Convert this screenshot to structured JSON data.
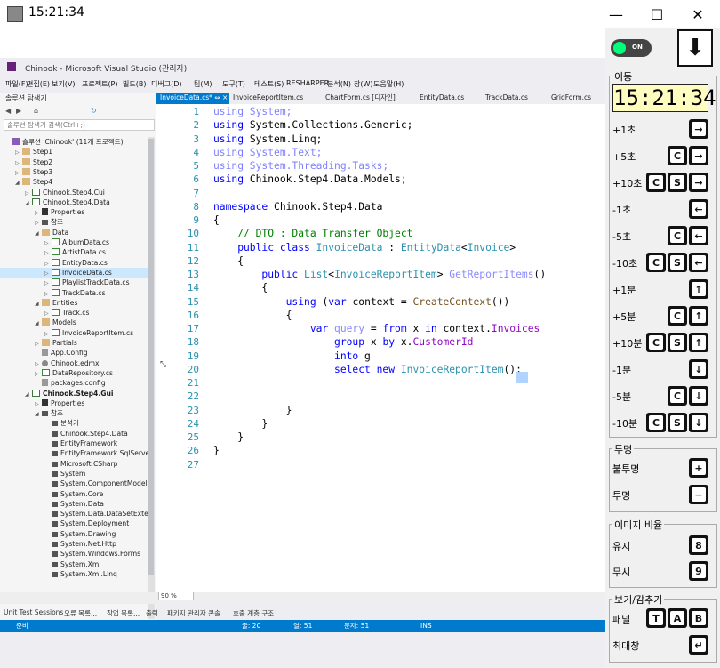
{
  "outer": {
    "time": "15:21:34",
    "minimize": "—",
    "maximize": "☐",
    "close": "✕"
  },
  "vs": {
    "title": "Chinook - Microsoft Visual Studio (관리자)",
    "menu": [
      "파일(F)",
      "편집(E)",
      "보기(V)",
      "프로젝트(P)",
      "빌드(B)",
      "디버그(D)",
      "팀(M)",
      "도구(T)",
      "테스트(S)",
      "RESHARPER",
      "분석(N)",
      "창(W)",
      "도움말(H)"
    ],
    "solution_explorer": {
      "header": "솔루션 탐색기",
      "search_placeholder": "솔루션 탐색기 검색(Ctrl+;)",
      "items": [
        {
          "text": "솔루션 'Chinook' (11개 프로젝트)",
          "indent": 0,
          "icon": "sol",
          "tri": ""
        },
        {
          "text": "Step1",
          "indent": 1,
          "icon": "folder",
          "tri": "▷"
        },
        {
          "text": "Step2",
          "indent": 1,
          "icon": "folder",
          "tri": "▷"
        },
        {
          "text": "Step3",
          "indent": 1,
          "icon": "folder",
          "tri": "▷"
        },
        {
          "text": "Step4",
          "indent": 1,
          "icon": "folder",
          "tri": "◢"
        },
        {
          "text": "Chinook.Step4.Cui",
          "indent": 2,
          "icon": "proj",
          "tri": "▷"
        },
        {
          "text": "Chinook.Step4.Data",
          "indent": 2,
          "icon": "proj",
          "tri": "◢"
        },
        {
          "text": "Properties",
          "indent": 3,
          "icon": "wrench",
          "tri": "▷"
        },
        {
          "text": "참조",
          "indent": 3,
          "icon": "ref",
          "tri": "▷"
        },
        {
          "text": "Data",
          "indent": 3,
          "icon": "folder",
          "tri": "◢"
        },
        {
          "text": "AlbumData.cs",
          "indent": 4,
          "icon": "cs",
          "tri": "▷"
        },
        {
          "text": "ArtistData.cs",
          "indent": 4,
          "icon": "cs",
          "tri": "▷"
        },
        {
          "text": "EntityData.cs",
          "indent": 4,
          "icon": "cs",
          "tri": "▷"
        },
        {
          "text": "InvoiceData.cs",
          "indent": 4,
          "icon": "cs",
          "tri": "▷",
          "selected": true
        },
        {
          "text": "PlaylistTrackData.cs",
          "indent": 4,
          "icon": "cs",
          "tri": "▷"
        },
        {
          "text": "TrackData.cs",
          "indent": 4,
          "icon": "cs",
          "tri": "▷"
        },
        {
          "text": "Entities",
          "indent": 3,
          "icon": "folder",
          "tri": "◢"
        },
        {
          "text": "Track.cs",
          "indent": 4,
          "icon": "cs",
          "tri": "▷"
        },
        {
          "text": "Models",
          "indent": 3,
          "icon": "folder",
          "tri": "◢"
        },
        {
          "text": "InvoiceReportItem.cs",
          "indent": 4,
          "icon": "cs",
          "tri": "▷"
        },
        {
          "text": "Partials",
          "indent": 3,
          "icon": "folder",
          "tri": "▷"
        },
        {
          "text": "App.Config",
          "indent": 3,
          "icon": "cfg",
          "tri": ""
        },
        {
          "text": "Chinook.edmx",
          "indent": 3,
          "icon": "gear",
          "tri": "▷"
        },
        {
          "text": "DataRepository.cs",
          "indent": 3,
          "icon": "cs",
          "tri": "▷"
        },
        {
          "text": "packages.config",
          "indent": 3,
          "icon": "cfg",
          "tri": ""
        },
        {
          "text": "Chinook.Step4.Gui",
          "indent": 2,
          "icon": "proj",
          "tri": "◢",
          "bold": true
        },
        {
          "text": "Properties",
          "indent": 3,
          "icon": "wrench",
          "tri": "▷"
        },
        {
          "text": "참조",
          "indent": 3,
          "icon": "ref",
          "tri": "◢"
        },
        {
          "text": "분석기",
          "indent": 4,
          "icon": "ref",
          "tri": ""
        },
        {
          "text": "Chinook.Step4.Data",
          "indent": 4,
          "icon": "ref",
          "tri": ""
        },
        {
          "text": "EntityFramework",
          "indent": 4,
          "icon": "ref",
          "tri": ""
        },
        {
          "text": "EntityFramework.SqlServer",
          "indent": 4,
          "icon": "ref",
          "tri": ""
        },
        {
          "text": "Microsoft.CSharp",
          "indent": 4,
          "icon": "ref",
          "tri": ""
        },
        {
          "text": "System",
          "indent": 4,
          "icon": "ref",
          "tri": ""
        },
        {
          "text": "System.ComponentModel.D",
          "indent": 4,
          "icon": "ref",
          "tri": ""
        },
        {
          "text": "System.Core",
          "indent": 4,
          "icon": "ref",
          "tri": ""
        },
        {
          "text": "System.Data",
          "indent": 4,
          "icon": "ref",
          "tri": ""
        },
        {
          "text": "System.Data.DataSetExtens",
          "indent": 4,
          "icon": "ref",
          "tri": ""
        },
        {
          "text": "System.Deployment",
          "indent": 4,
          "icon": "ref",
          "tri": ""
        },
        {
          "text": "System.Drawing",
          "indent": 4,
          "icon": "ref",
          "tri": ""
        },
        {
          "text": "System.Net.Http",
          "indent": 4,
          "icon": "ref",
          "tri": ""
        },
        {
          "text": "System.Windows.Forms",
          "indent": 4,
          "icon": "ref",
          "tri": ""
        },
        {
          "text": "System.Xml",
          "indent": 4,
          "icon": "ref",
          "tri": ""
        },
        {
          "text": "System.Xml.Linq",
          "indent": 4,
          "icon": "ref",
          "tri": ""
        }
      ]
    },
    "tabs": [
      "InvoiceData.cs* ⇔ ×",
      "InvoiceReportItem.cs",
      "ChartForm.cs [디자인]",
      "EntityData.cs",
      "TrackData.cs",
      "GridForm.cs"
    ],
    "code_lines": [
      [
        {
          "t": "using System;",
          "c": "dim-kw"
        }
      ],
      [
        {
          "t": "using ",
          "c": "kw"
        },
        {
          "t": "System.Collections.Generic;",
          "c": ""
        }
      ],
      [
        {
          "t": "using ",
          "c": "kw"
        },
        {
          "t": "System.Linq;",
          "c": ""
        }
      ],
      [
        {
          "t": "using System.Text;",
          "c": "dim-kw"
        }
      ],
      [
        {
          "t": "using System.Threading.Tasks;",
          "c": "dim-kw"
        }
      ],
      [
        {
          "t": "using ",
          "c": "kw"
        },
        {
          "t": "Chinook.Step4.Data.Models;",
          "c": ""
        }
      ],
      [],
      [
        {
          "t": "namespace ",
          "c": "kw"
        },
        {
          "t": "Chinook.Step4.Data",
          "c": ""
        }
      ],
      [
        {
          "t": "{",
          "c": ""
        }
      ],
      [
        {
          "t": "    // DTO : Data Transfer Object",
          "c": "cm"
        }
      ],
      [
        {
          "t": "    public class ",
          "c": "kw"
        },
        {
          "t": "InvoiceData",
          "c": "ty"
        },
        {
          "t": " : ",
          "c": ""
        },
        {
          "t": "EntityData",
          "c": "ty"
        },
        {
          "t": "<",
          "c": ""
        },
        {
          "t": "Invoice",
          "c": "ty"
        },
        {
          "t": ">",
          "c": ""
        }
      ],
      [
        {
          "t": "    {",
          "c": ""
        }
      ],
      [
        {
          "t": "        public ",
          "c": "kw"
        },
        {
          "t": "List",
          "c": "ty"
        },
        {
          "t": "<",
          "c": ""
        },
        {
          "t": "InvoiceReportItem",
          "c": "ty"
        },
        {
          "t": "> ",
          "c": ""
        },
        {
          "t": "GetReportItems",
          "c": "fd"
        },
        {
          "t": "()",
          "c": ""
        }
      ],
      [
        {
          "t": "        {",
          "c": ""
        }
      ],
      [
        {
          "t": "            using ",
          "c": "kw"
        },
        {
          "t": "(",
          "c": ""
        },
        {
          "t": "var ",
          "c": "kw"
        },
        {
          "t": "context = ",
          "c": ""
        },
        {
          "t": "CreateContext",
          "c": "mt"
        },
        {
          "t": "())",
          "c": ""
        }
      ],
      [
        {
          "t": "            {",
          "c": ""
        }
      ],
      [
        {
          "t": "                var ",
          "c": "kw"
        },
        {
          "t": "query",
          "c": "fd"
        },
        {
          "t": " = ",
          "c": ""
        },
        {
          "t": "from ",
          "c": "kw"
        },
        {
          "t": "x ",
          "c": ""
        },
        {
          "t": "in ",
          "c": "kw"
        },
        {
          "t": "context.",
          "c": ""
        },
        {
          "t": "Invoices",
          "c": "pr"
        }
      ],
      [
        {
          "t": "                    group ",
          "c": "kw"
        },
        {
          "t": "x ",
          "c": ""
        },
        {
          "t": "by ",
          "c": "kw"
        },
        {
          "t": "x.",
          "c": ""
        },
        {
          "t": "CustomerId",
          "c": "pr"
        }
      ],
      [
        {
          "t": "                    into ",
          "c": "kw"
        },
        {
          "t": "g",
          "c": ""
        }
      ],
      [
        {
          "t": "                    select new ",
          "c": "kw"
        },
        {
          "t": "InvoiceReportItem",
          "c": "ty"
        },
        {
          "t": "();",
          "c": ""
        }
      ],
      [],
      [],
      [
        {
          "t": "            }",
          "c": ""
        }
      ],
      [
        {
          "t": "        }",
          "c": ""
        }
      ],
      [
        {
          "t": "    }",
          "c": ""
        }
      ],
      [
        {
          "t": "}",
          "c": ""
        }
      ],
      []
    ],
    "zoom": "90 %",
    "bottom_tabs": [
      "Unit Test Sessions",
      "오류 목록...",
      "작업 목록...",
      "출력",
      "패키지 관리자 콘솔",
      "호출 계층 구조"
    ],
    "status": {
      "ready": "준비",
      "line": "줄: 20",
      "col": "열: 51",
      "char": "문자: 51",
      "mode": "INS"
    }
  },
  "panel": {
    "toggle": "ON",
    "move_title": "이동",
    "clock": "15:21:34",
    "moves": [
      {
        "label": "+1초",
        "keys": [
          "→"
        ]
      },
      {
        "label": "+5초",
        "keys": [
          "C",
          "→"
        ]
      },
      {
        "label": "+10초",
        "keys": [
          "C",
          "S",
          "→"
        ]
      },
      {
        "label": "-1초",
        "keys": [
          "←"
        ]
      },
      {
        "label": "-5초",
        "keys": [
          "C",
          "←"
        ]
      },
      {
        "label": "-10초",
        "keys": [
          "C",
          "S",
          "←"
        ]
      },
      {
        "label": "+1분",
        "keys": [
          "↑"
        ]
      },
      {
        "label": "+5분",
        "keys": [
          "C",
          "↑"
        ]
      },
      {
        "label": "+10분",
        "keys": [
          "C",
          "S",
          "↑"
        ]
      },
      {
        "label": "-1분",
        "keys": [
          "↓"
        ]
      },
      {
        "label": "-5분",
        "keys": [
          "C",
          "↓"
        ]
      },
      {
        "label": "-10분",
        "keys": [
          "C",
          "S",
          "↓"
        ]
      }
    ],
    "opacity_title": "투명",
    "opacity": [
      {
        "label": "불투명",
        "keys": [
          "+"
        ]
      },
      {
        "label": "투명",
        "keys": [
          "−"
        ]
      }
    ],
    "ratio_title": "이미지 비율",
    "ratio": [
      {
        "label": "유지",
        "keys": [
          "8"
        ]
      },
      {
        "label": "무시",
        "keys": [
          "9"
        ]
      }
    ],
    "view_title": "보기/감추기",
    "view": [
      {
        "label": "패널",
        "keys": [
          "T",
          "A",
          "B"
        ]
      },
      {
        "label": "최대창",
        "keys": [
          "↵"
        ]
      }
    ]
  }
}
